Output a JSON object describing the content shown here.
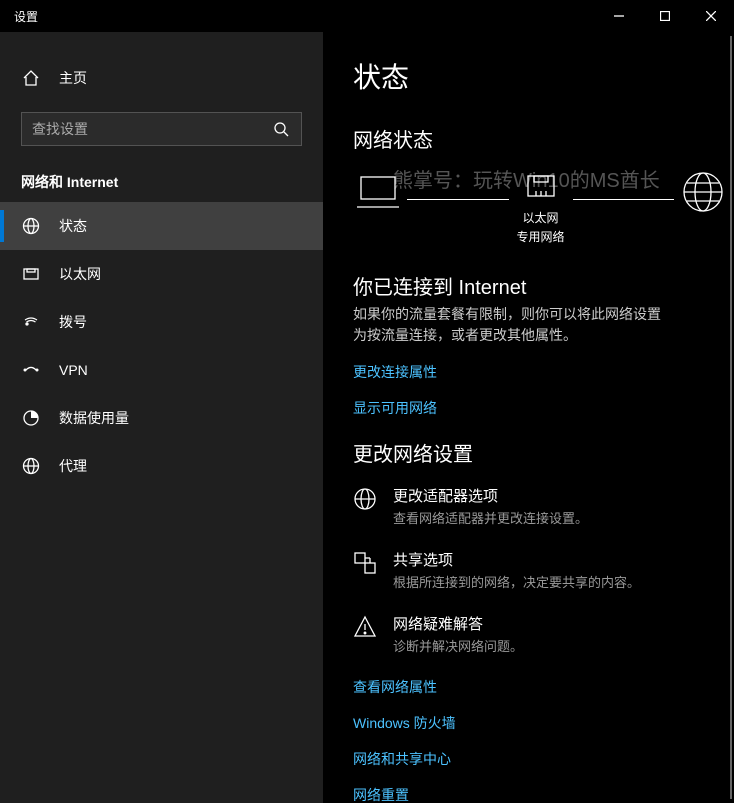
{
  "window": {
    "title": "设置"
  },
  "sidebar": {
    "home": "主页",
    "search_placeholder": "查找设置",
    "section": "网络和 Internet",
    "items": [
      {
        "label": "状态"
      },
      {
        "label": "以太网"
      },
      {
        "label": "拨号"
      },
      {
        "label": "VPN"
      },
      {
        "label": "数据使用量"
      },
      {
        "label": "代理"
      }
    ]
  },
  "main": {
    "title": "状态",
    "section1": "网络状态",
    "diagram": {
      "mid_top": "以太网",
      "mid_bottom": "专用网络"
    },
    "watermark": "熊掌号：玩转Win10的MS酋长",
    "connected_heading": "你已连接到 Internet",
    "connected_body": "如果你的流量套餐有限制，则你可以将此网络设置为按流量连接，或者更改其他属性。",
    "link_conn_props": "更改连接属性",
    "link_show_nets": "显示可用网络",
    "section2": "更改网络设置",
    "opts": [
      {
        "title": "更改适配器选项",
        "desc": "查看网络适配器并更改连接设置。"
      },
      {
        "title": "共享选项",
        "desc": "根据所连接到的网络，决定要共享的内容。"
      },
      {
        "title": "网络疑难解答",
        "desc": "诊断并解决网络问题。"
      }
    ],
    "link_net_props": "查看网络属性",
    "link_firewall": "Windows 防火墙",
    "link_sharing": "网络和共享中心",
    "link_reset": "网络重置"
  }
}
